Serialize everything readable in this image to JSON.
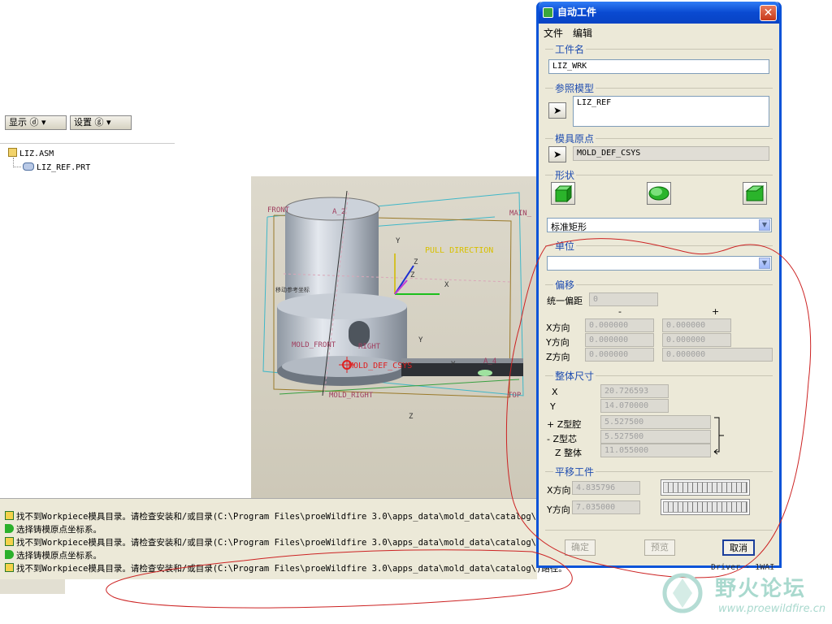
{
  "tree": {
    "display_btn": "显示 ⓓ ▾",
    "settings_btn": "设置 ⓖ ▾",
    "root": "LIZ.ASM",
    "child": "LIZ_REF.PRT"
  },
  "graphics": {
    "front": "FRONT",
    "main": "MAIN_",
    "pull": "PULL DIRECTION",
    "a2": "A_2",
    "y": "Y",
    "x": "X",
    "z": "Z",
    "z1": "Z",
    "mold_front": "MOLD_FRONT",
    "right": "RIGHT",
    "csys": "MOLD_DEF_CSYS",
    "a4": "A_4",
    "top": "TOP",
    "mold_right": "MOLD_RIGHT",
    "y2": "Y",
    "y3": "Y",
    "z2": "Z",
    "small": "移动参考坐标"
  },
  "messages": [
    {
      "type": "warn",
      "text": "找不到Workpiece模具目录。请检查安装和/或目录(C:\\Program Files\\proeWildfire 3.0\\apps_data\\mold_data\\catalog\\"
    },
    {
      "type": "prompt",
      "text": "选择铸模原点坐标系。"
    },
    {
      "type": "warn",
      "text": "找不到Workpiece模具目录。请检查安装和/或目录(C:\\Program Files\\proeWildfire 3.0\\apps_data\\mold_data\\catalog\\"
    },
    {
      "type": "prompt",
      "text": "选择铸模原点坐标系。"
    },
    {
      "type": "warn",
      "text": "找不到Workpiece模具目录。请检查安装和/或目录(C:\\Program Files\\proeWildfire 3.0\\apps_data\\mold_data\\catalog\\)路径。"
    }
  ],
  "dialog": {
    "title": "自动工件",
    "menu": [
      "文件",
      "编辑"
    ],
    "workpiece_name_label": "工件名",
    "workpiece_name": "LIZ_WRK",
    "ref_model_label": "参照模型",
    "ref_model": "LIZ_REF",
    "mold_origin_label": "模具原点",
    "mold_origin": "MOLD_DEF_CSYS",
    "shape_label": "形状",
    "shape_select": "标准矩形",
    "unit_label": "单位",
    "unit_select": "",
    "offset_label": "偏移",
    "uniform_offset_label": "统一偏距",
    "uniform_offset": "0",
    "minus": "-",
    "plus": "+",
    "x_dir": "X方向",
    "y_dir": "Y方向",
    "z_dir": "Z方向",
    "x_minus": "0.000000",
    "x_plus": "0.000000",
    "y_minus": "0.000000",
    "y_plus": "0.000000",
    "z_minus": "0.000000",
    "z_plus": "0.000000",
    "overall_label": "整体尺寸",
    "dim_x_label": "X",
    "dim_x": "20.726593",
    "dim_y_label": "Y",
    "dim_y": "14.070000",
    "z_cavity_label": "+ Z型腔",
    "z_cavity": "5.527500",
    "z_core_label": "- Z型芯",
    "z_core": "5.527500",
    "z_total_label": "Z 整体",
    "z_total": "11.055000",
    "translate_label": "平移工件",
    "tx_label": "X方向",
    "tx": "4.835796",
    "ty_label": "Y方向",
    "ty": "7.035000",
    "ok": "确定",
    "preview": "预览",
    "cancel": "取消"
  },
  "status_right": "Driver - 1WAI",
  "watermark": {
    "title": "野火论坛",
    "url": "www.proewildfire.cn"
  },
  "colors": {
    "title_bar": "#0a4ad1",
    "section_label": "#1e4cb0",
    "annotation": "#cc2222",
    "model": "#b8bfc8"
  }
}
